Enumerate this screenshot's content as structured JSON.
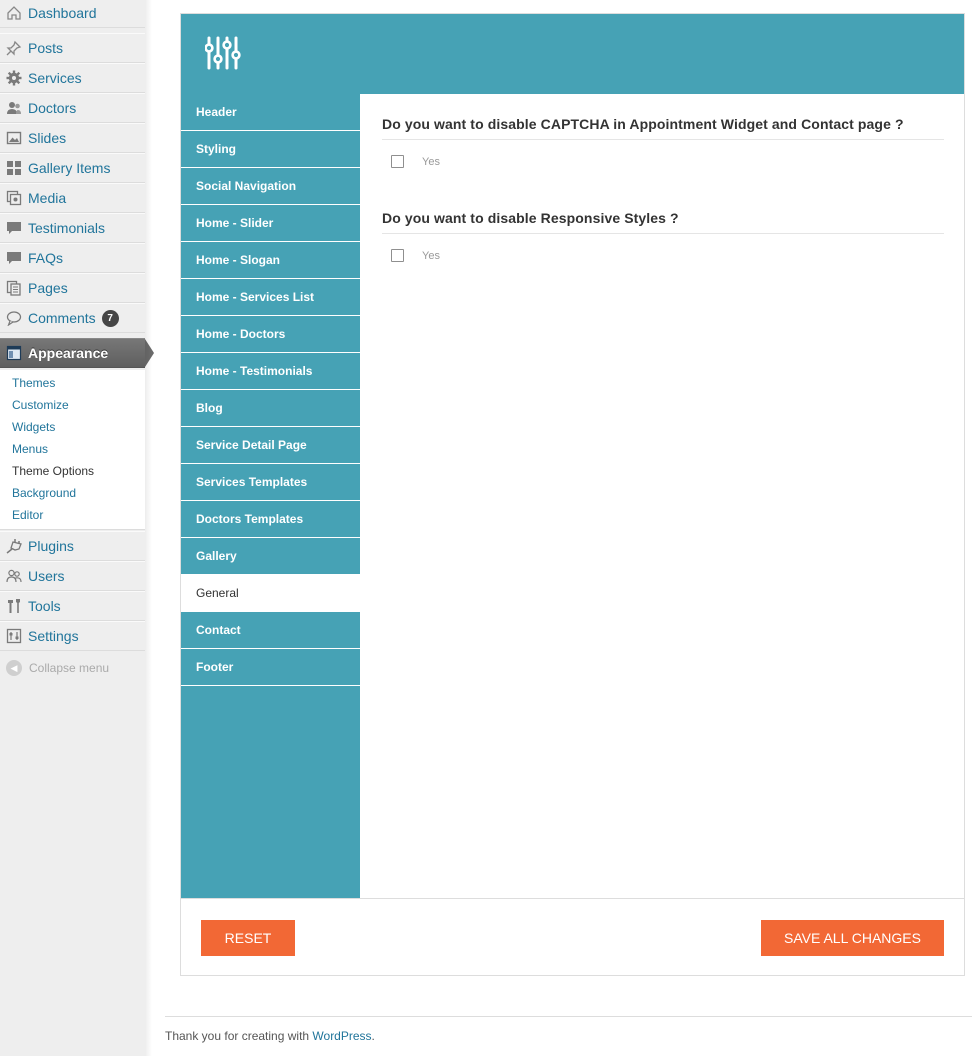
{
  "sidebar": {
    "items": [
      {
        "label": "Dashboard",
        "icon": "dashboard-icon"
      },
      {
        "label": "Posts",
        "icon": "pushpin-icon"
      },
      {
        "label": "Services",
        "icon": "gear-icon"
      },
      {
        "label": "Doctors",
        "icon": "users-icon"
      },
      {
        "label": "Slides",
        "icon": "image-icon"
      },
      {
        "label": "Gallery Items",
        "icon": "grid-icon"
      },
      {
        "label": "Media",
        "icon": "media-icon"
      },
      {
        "label": "Testimonials",
        "icon": "speech-bubble-icon"
      },
      {
        "label": "FAQs",
        "icon": "speech-bubble-icon"
      },
      {
        "label": "Pages",
        "icon": "pages-icon"
      },
      {
        "label": "Comments",
        "icon": "comment-icon",
        "badge": "7"
      },
      {
        "label": "Appearance",
        "icon": "appearance-icon"
      },
      {
        "label": "Plugins",
        "icon": "plug-icon"
      },
      {
        "label": "Users",
        "icon": "users-icon"
      },
      {
        "label": "Tools",
        "icon": "tools-icon"
      },
      {
        "label": "Settings",
        "icon": "settings-icon"
      }
    ],
    "submenu": [
      "Themes",
      "Customize",
      "Widgets",
      "Menus",
      "Theme Options",
      "Background",
      "Editor"
    ],
    "submenu_active": "Theme Options",
    "collapse_label": "Collapse menu"
  },
  "panel": {
    "logo_icon": "sliders-icon",
    "tabs": [
      "Header",
      "Styling",
      "Social Navigation",
      "Home - Slider",
      "Home - Slogan",
      "Home - Services List",
      "Home - Doctors",
      "Home - Testimonials",
      "Blog",
      "Service Detail Page",
      "Services Templates",
      "Doctors Templates",
      "Gallery",
      "General",
      "Contact",
      "Footer"
    ],
    "active_tab": "General",
    "questions": [
      {
        "title": "Do you want to disable CAPTCHA in Appointment Widget and Contact page ?",
        "option": "Yes",
        "checked": false
      },
      {
        "title": "Do you want to disable Responsive Styles ?",
        "option": "Yes",
        "checked": false
      }
    ],
    "reset_label": "RESET",
    "save_label": "SAVE ALL CHANGES"
  },
  "footer": {
    "text": "Thank you for creating with ",
    "link": "WordPress",
    "suffix": "."
  },
  "colors": {
    "teal": "#46a2b5",
    "orange": "#f26835",
    "link": "#21759b"
  }
}
